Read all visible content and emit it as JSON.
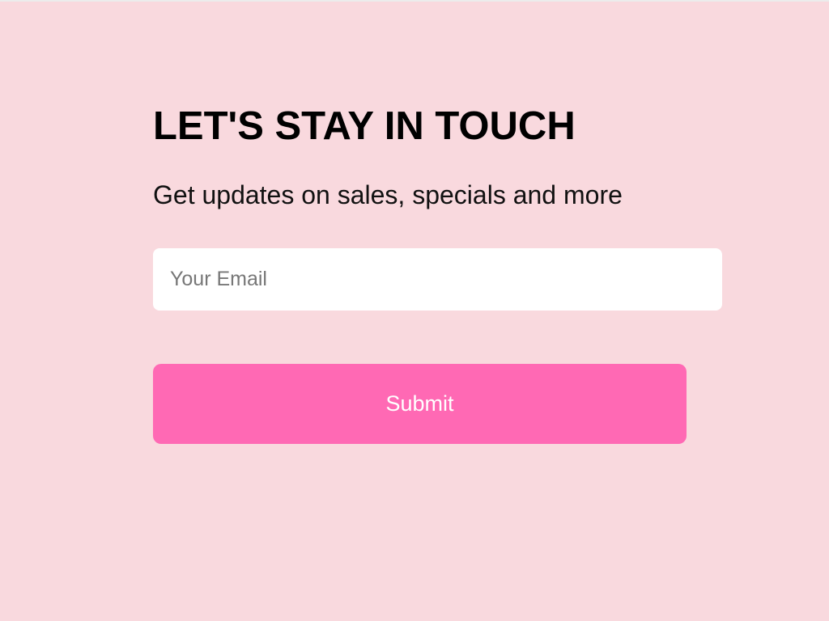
{
  "signup": {
    "heading": "LET'S STAY IN TOUCH",
    "subheading": "Get updates on sales, specials and more",
    "email": {
      "placeholder": "Your Email",
      "value": ""
    },
    "submit_label": "Submit"
  },
  "colors": {
    "background": "#f9d9de",
    "button": "#ff69b4",
    "button_text": "#ffffff",
    "input_background": "#ffffff",
    "heading": "#000000"
  }
}
